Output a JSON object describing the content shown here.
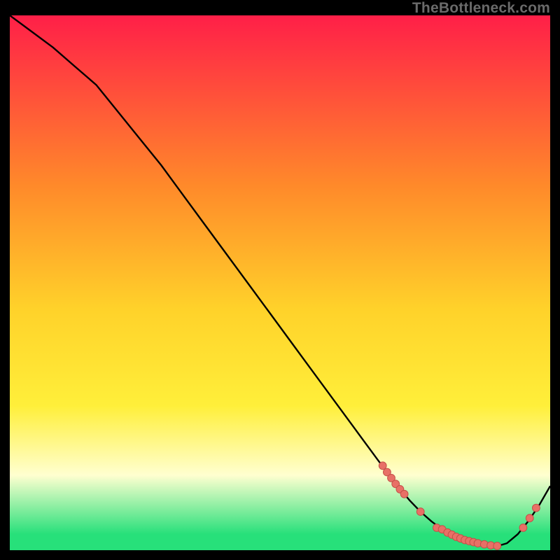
{
  "watermark": "TheBottleneck.com",
  "colors": {
    "top": "#ff1f48",
    "mid_upper": "#ff8a2a",
    "mid": "#ffd22a",
    "mid_lower": "#ffef3a",
    "pale": "#ffffd0",
    "green": "#27e07a",
    "curve": "#000000",
    "marker_fill": "#e87066",
    "marker_stroke": "#c45048"
  },
  "chart_data": {
    "type": "line",
    "title": "",
    "xlabel": "",
    "ylabel": "",
    "xlim": [
      0,
      100
    ],
    "ylim": [
      0,
      100
    ],
    "series": [
      {
        "name": "bottleneck-curve",
        "x": [
          0,
          4,
          8,
          12,
          16,
          20,
          24,
          28,
          32,
          36,
          40,
          44,
          48,
          52,
          56,
          60,
          64,
          68,
          70,
          72,
          74,
          76,
          78,
          80,
          82,
          84,
          86,
          88,
          90,
          92,
          94,
          96,
          98,
          100
        ],
        "y": [
          100,
          97,
          94,
          90.5,
          87,
          82,
          77,
          72,
          66.5,
          61,
          55.5,
          50,
          44.5,
          39,
          33.5,
          28,
          22.5,
          17,
          14.3,
          11.7,
          9.3,
          7.2,
          5.4,
          3.9,
          2.7,
          1.8,
          1.2,
          0.8,
          0.7,
          1.3,
          3.0,
          5.5,
          8.5,
          12.0
        ]
      }
    ],
    "markers": {
      "name": "highlighted-points",
      "x": [
        69.0,
        69.8,
        70.6,
        71.4,
        72.2,
        73.0,
        76.0,
        79.0,
        80.0,
        81.0,
        81.8,
        82.6,
        83.4,
        84.2,
        85.0,
        85.8,
        86.6,
        87.8,
        89.0,
        90.2,
        95.0,
        96.2,
        97.4
      ],
      "y": [
        15.8,
        14.6,
        13.5,
        12.4,
        11.4,
        10.5,
        7.2,
        4.2,
        3.9,
        3.3,
        2.9,
        2.5,
        2.2,
        1.9,
        1.7,
        1.5,
        1.3,
        1.1,
        0.9,
        0.8,
        4.2,
        6.0,
        7.9
      ]
    }
  }
}
